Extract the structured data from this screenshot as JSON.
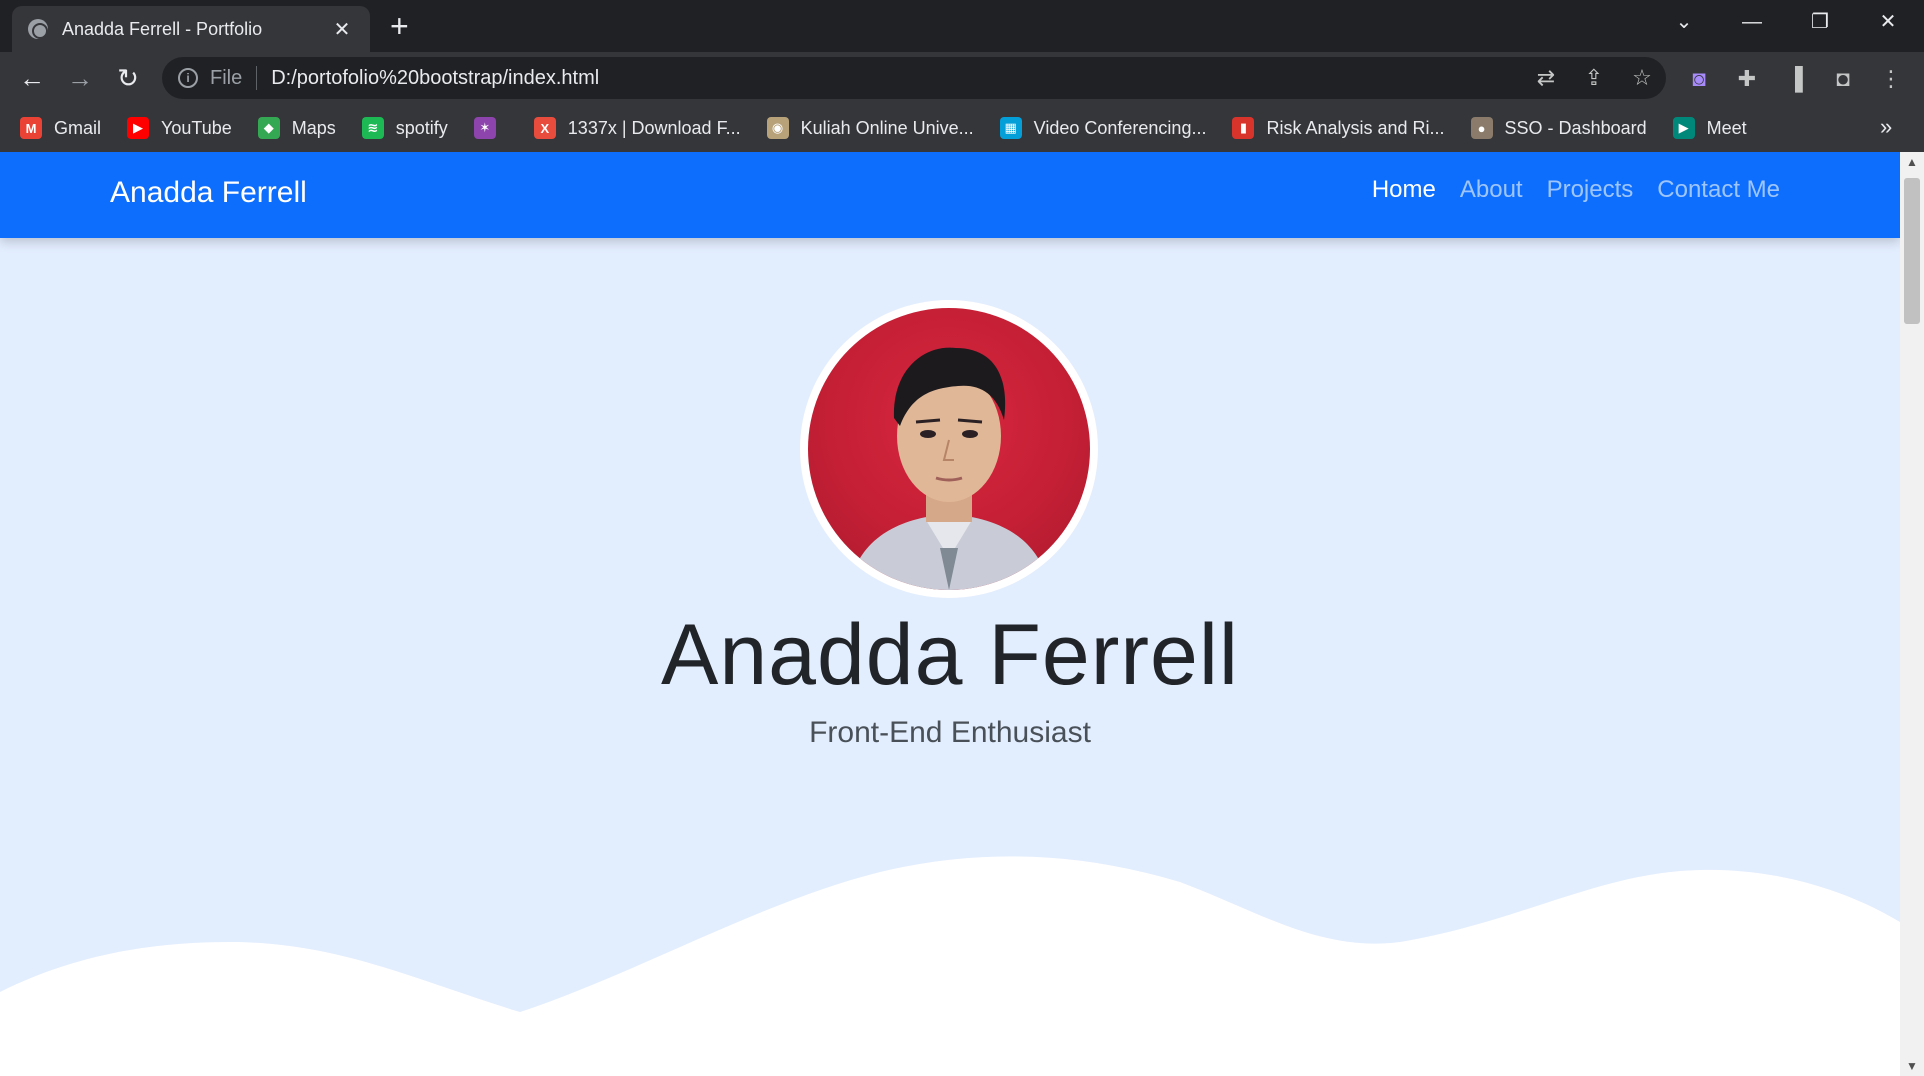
{
  "browser": {
    "tab_title": "Anadda Ferrell - Portfolio",
    "tab_close": "✕",
    "new_tab": "+",
    "scheme_label": "File",
    "url": "D:/portofolio%20bootstrap/index.html",
    "window_controls": {
      "dropdown": "⌄",
      "minimize": "—",
      "restore": "❐",
      "close": "✕"
    },
    "nav": {
      "back": "←",
      "forward": "→",
      "reload": "↻",
      "menu": "⋮"
    },
    "bookmarks": [
      {
        "label": "Gmail",
        "icon": "gmail-icon",
        "color": "#ea4335",
        "glyph": "M"
      },
      {
        "label": "YouTube",
        "icon": "youtube-icon",
        "color": "#ff0000",
        "glyph": "▶"
      },
      {
        "label": "Maps",
        "icon": "maps-icon",
        "color": "#34a853",
        "glyph": "◆"
      },
      {
        "label": "spotify",
        "icon": "spotify-icon",
        "color": "#1db954",
        "glyph": "≋"
      },
      {
        "label": "",
        "icon": "pinwheel-icon",
        "color": "#8e44ad",
        "glyph": "✶"
      },
      {
        "label": "1337x | Download F...",
        "icon": "x-icon",
        "color": "#e74c3c",
        "glyph": "X"
      },
      {
        "label": "Kuliah Online Unive...",
        "icon": "university-icon",
        "color": "#b8a27a",
        "glyph": "◉"
      },
      {
        "label": "Video Conferencing...",
        "icon": "cisco-icon",
        "color": "#049fd9",
        "glyph": "▦"
      },
      {
        "label": "Risk Analysis and Ri...",
        "icon": "chart-icon",
        "color": "#d9342b",
        "glyph": "▮"
      },
      {
        "label": "SSO - Dashboard",
        "icon": "sso-icon",
        "color": "#8a7b6a",
        "glyph": "●"
      },
      {
        "label": "Meet",
        "icon": "meet-icon",
        "color": "#00897b",
        "glyph": "▶"
      }
    ],
    "bookmarks_more": "»"
  },
  "site": {
    "brand": "Anadda Ferrell",
    "nav_links": [
      "Home",
      "About",
      "Projects",
      "Contact Me"
    ],
    "active_link": "Home",
    "hero_name": "Anadda Ferrell",
    "hero_subtitle": "Front-End Enthusiast",
    "colors": {
      "navbar": "#0d6efd",
      "background": "#e2edfe",
      "wave": "#ffffff"
    }
  }
}
